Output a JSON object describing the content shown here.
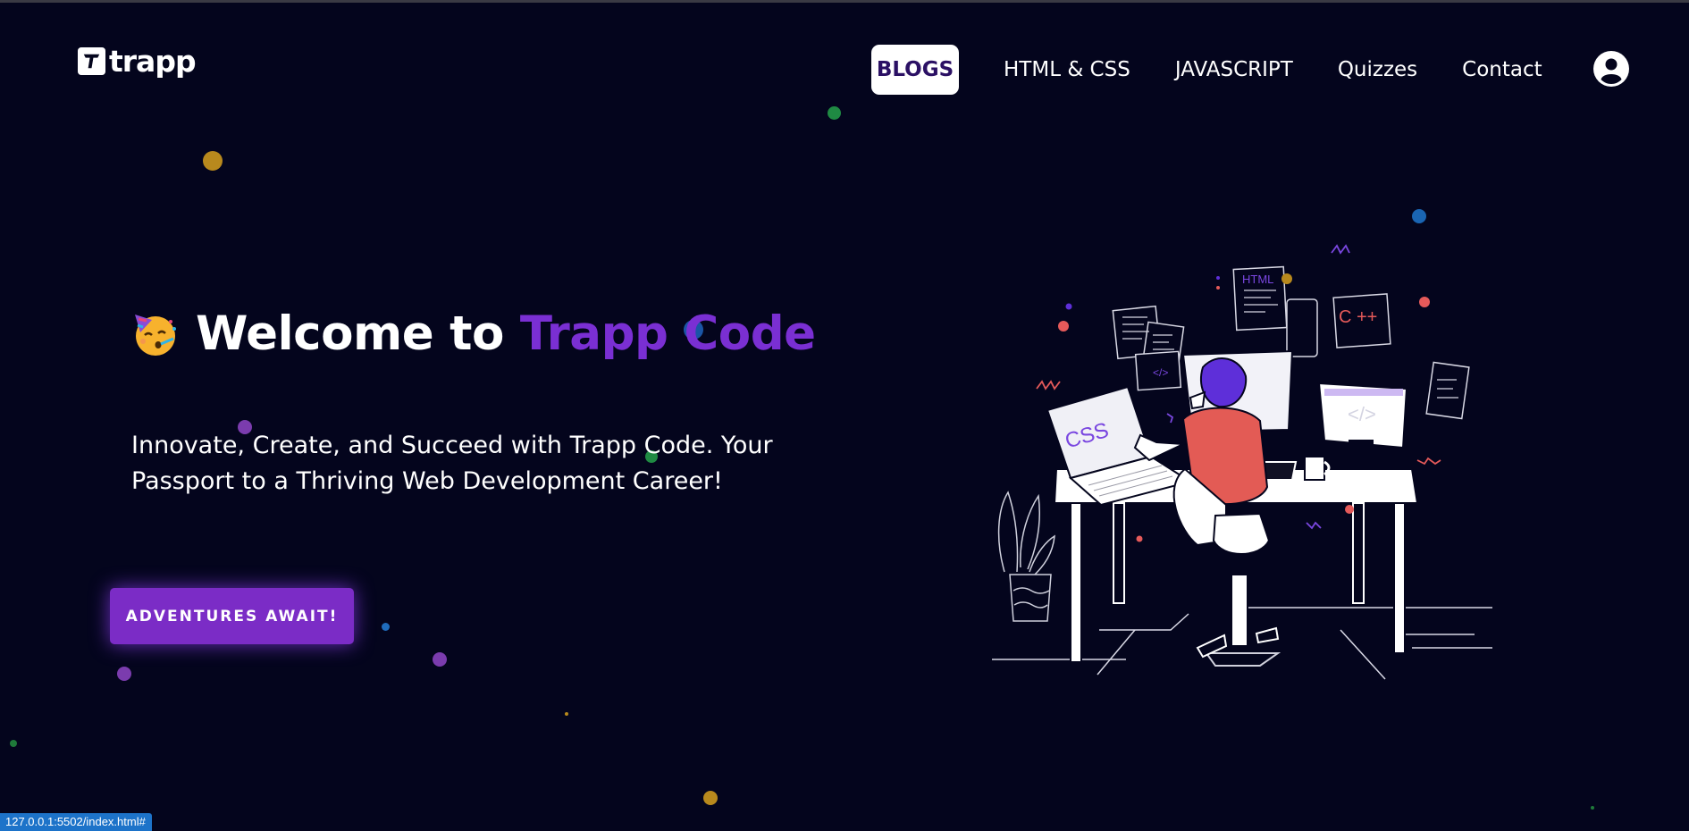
{
  "brand": {
    "name": "trapp"
  },
  "nav": {
    "items": [
      {
        "label": "BLOGS",
        "active": true
      },
      {
        "label": "HTML & CSS",
        "active": false
      },
      {
        "label": "JAVASCRIPT",
        "active": false
      },
      {
        "label": "Quizzes",
        "active": false
      },
      {
        "label": "Contact",
        "active": false
      }
    ],
    "profile_icon": "user-circle-icon"
  },
  "hero": {
    "emoji": "partying-face",
    "title_prefix": "Welcome to",
    "title_accent": "Trapp Code",
    "subtitle": "Innovate, Create, and Succeed with Trapp Code. Your Passport to a Thriving Web Development Career!",
    "cta_label": "ADVENTURES AWAIT!"
  },
  "illustration": {
    "description_icon": "developer-at-desk-illustration",
    "labels": {
      "html": "HTML",
      "css": "CSS",
      "cpp": "C ++"
    }
  },
  "status_bar": {
    "url": "127.0.0.1:5502/index.html#"
  },
  "colors": {
    "background": "#04051d",
    "accent": "#7a2fd3",
    "button": "#7b2cc6",
    "nav_active_bg": "#ffffff",
    "nav_active_text": "#2b1064"
  }
}
